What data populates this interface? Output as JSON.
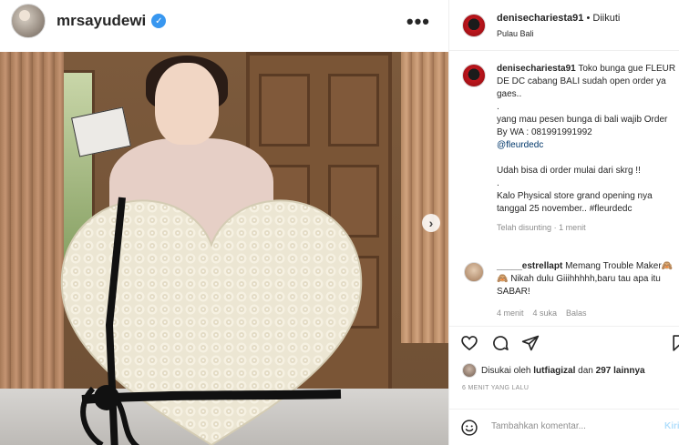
{
  "post": {
    "author": "mrsayudewi",
    "more_icon": "more-horizontal-icon"
  },
  "right_header": {
    "username": "denisechariesta91",
    "separator": "•",
    "follow_status": "Diikuti",
    "location": "Pulau Bali"
  },
  "caption": {
    "username": "denisechariesta91",
    "lines": [
      "Toko bunga gue FLEUR DE DC cabang BALI sudah open order ya gaes..",
      ".",
      "yang mau pesen bunga di bali wajib Order By WA : 081991991992",
      "@fleurdedc",
      "",
      "Udah bisa di order mulai dari skrg !!",
      ".",
      "Kalo Physical store grand opening nya tanggal 25 november.. #fleurdedc"
    ],
    "edited": "Telah disunting",
    "edited_sep": "·",
    "edited_time": "1 menit"
  },
  "comment": {
    "username": "_____estrellapt",
    "text": "Memang Trouble Maker🙈🙈 Nikah dulu Giiihhhhh,baru tau apa itu SABAR!",
    "time": "4 menit",
    "likes": "4 suka",
    "reply": "Balas"
  },
  "likes": {
    "prefix": "Disukai oleh",
    "user": "lutfiagizal",
    "middle": "dan",
    "count": "297 lainnya"
  },
  "timestamp": "6 MENIT YANG LALU",
  "comment_box": {
    "placeholder": "Tambahkan komentar...",
    "post_label": "Kirim"
  },
  "colors": {
    "link": "#00376b",
    "muted": "#8e8e8e",
    "verified": "#3897f0"
  }
}
